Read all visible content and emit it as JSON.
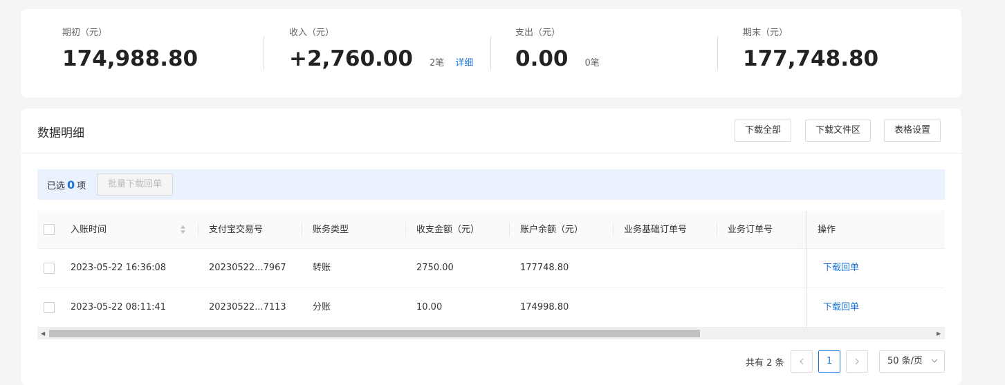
{
  "summary": {
    "opening": {
      "label": "期初（元）",
      "value": "174,988.80"
    },
    "income": {
      "label": "收入（元）",
      "value": "+2,760.00",
      "count": "2笔",
      "link": "详细"
    },
    "expense": {
      "label": "支出（元）",
      "value": "0.00",
      "count": "0笔"
    },
    "closing": {
      "label": "期末（元）",
      "value": "177,748.80"
    }
  },
  "detail": {
    "title": "数据明细",
    "buttons": {
      "download_all": "下载全部",
      "download_files": "下载文件区",
      "table_settings": "表格设置"
    }
  },
  "selection": {
    "prefix": "已选",
    "count": "0",
    "suffix": "项",
    "batch_button": "批量下载回单"
  },
  "table": {
    "columns": [
      "入账时间",
      "支付宝交易号",
      "账务类型",
      "收支金额（元）",
      "账户余额（元）",
      "业务基础订单号",
      "业务订单号",
      "操作"
    ],
    "rows": [
      {
        "time": "2023-05-22 16:36:08",
        "trade_no": "20230522...7967",
        "type": "转账",
        "amount": "2750.00",
        "balance": "177748.80",
        "action": "下载回单"
      },
      {
        "time": "2023-05-22 08:11:41",
        "trade_no": "20230522...7113",
        "type": "分账",
        "amount": "10.00",
        "balance": "174998.80",
        "action": "下载回单"
      }
    ]
  },
  "pagination": {
    "total": "共有 2 条",
    "current_page": "1",
    "prev": "<",
    "next": ">",
    "page_size": "50 条/页"
  }
}
